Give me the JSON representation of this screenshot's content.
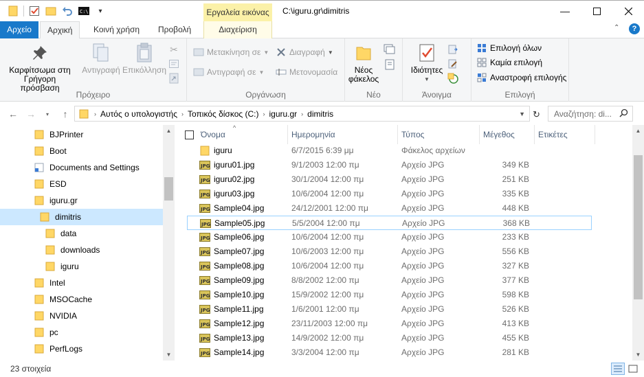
{
  "window": {
    "context_tab_title": "Εργαλεία εικόνας",
    "path_title": "C:\\iguru.gr\\dimitris"
  },
  "tabs": {
    "file": "Αρχείο",
    "home": "Αρχική",
    "share": "Κοινή χρήση",
    "view": "Προβολή",
    "manage": "Διαχείριση"
  },
  "ribbon": {
    "clipboard": {
      "label": "Πρόχειρο",
      "pin_line1": "Καρφίτσωμα στη",
      "pin_line2": "Γρήγορη πρόσβαση",
      "copy": "Αντιγραφή",
      "paste": "Επικόλληση"
    },
    "organize": {
      "label": "Οργάνωση",
      "move_to": "Μετακίνηση σε",
      "copy_to": "Αντιγραφή σε",
      "delete": "Διαγραφή",
      "rename": "Μετονομασία"
    },
    "new": {
      "label": "Νέο",
      "new_folder_line1": "Νέος",
      "new_folder_line2": "φάκελος"
    },
    "open": {
      "label": "Άνοιγμα",
      "properties": "Ιδιότητες"
    },
    "select": {
      "label": "Επιλογή",
      "select_all": "Επιλογή όλων",
      "select_none": "Καμία επιλογή",
      "invert": "Αναστροφή επιλογής"
    }
  },
  "address": {
    "crumbs": [
      "Αυτός ο υπολογιστής",
      "Τοπικός δίσκος (C:)",
      "iguru.gr",
      "dimitris"
    ],
    "search_placeholder": "Αναζήτηση: di..."
  },
  "tree": [
    {
      "label": "BJPrinter"
    },
    {
      "label": "Boot"
    },
    {
      "label": "Documents and Settings"
    },
    {
      "label": "ESD"
    },
    {
      "label": "iguru.gr"
    },
    {
      "label": "dimitris"
    },
    {
      "label": "data"
    },
    {
      "label": "downloads"
    },
    {
      "label": "iguru"
    },
    {
      "label": "Intel"
    },
    {
      "label": "MSOCache"
    },
    {
      "label": "NVIDIA"
    },
    {
      "label": "pc"
    },
    {
      "label": "PerfLogs"
    }
  ],
  "columns": {
    "name": "Όνομα",
    "date": "Ημερομηνία",
    "type": "Τύπος",
    "size": "Μέγεθος",
    "tags": "Ετικέτες"
  },
  "files": [
    {
      "name": "iguru",
      "date": "6/7/2015 6:39 μμ",
      "type": "Φάκελος αρχείων",
      "size": ""
    },
    {
      "name": "iguru01.jpg",
      "date": "9/1/2003 12:00 πμ",
      "type": "Αρχείο JPG",
      "size": "349 KB"
    },
    {
      "name": "iguru02.jpg",
      "date": "30/1/2004 12:00 πμ",
      "type": "Αρχείο JPG",
      "size": "251 KB"
    },
    {
      "name": "iguru03.jpg",
      "date": "10/6/2004 12:00 πμ",
      "type": "Αρχείο JPG",
      "size": "335 KB"
    },
    {
      "name": "Sample04.jpg",
      "date": "24/12/2001 12:00 πμ",
      "type": "Αρχείο JPG",
      "size": "448 KB"
    },
    {
      "name": "Sample05.jpg",
      "date": "5/5/2004 12:00 πμ",
      "type": "Αρχείο JPG",
      "size": "368 KB"
    },
    {
      "name": "Sample06.jpg",
      "date": "10/6/2004 12:00 πμ",
      "type": "Αρχείο JPG",
      "size": "233 KB"
    },
    {
      "name": "Sample07.jpg",
      "date": "10/6/2003 12:00 πμ",
      "type": "Αρχείο JPG",
      "size": "556 KB"
    },
    {
      "name": "Sample08.jpg",
      "date": "10/6/2004 12:00 πμ",
      "type": "Αρχείο JPG",
      "size": "327 KB"
    },
    {
      "name": "Sample09.jpg",
      "date": "8/8/2002 12:00 πμ",
      "type": "Αρχείο JPG",
      "size": "377 KB"
    },
    {
      "name": "Sample10.jpg",
      "date": "15/9/2002 12:00 πμ",
      "type": "Αρχείο JPG",
      "size": "598 KB"
    },
    {
      "name": "Sample11.jpg",
      "date": "1/6/2001 12:00 πμ",
      "type": "Αρχείο JPG",
      "size": "526 KB"
    },
    {
      "name": "Sample12.jpg",
      "date": "23/11/2003 12:00 πμ",
      "type": "Αρχείο JPG",
      "size": "413 KB"
    },
    {
      "name": "Sample13.jpg",
      "date": "14/9/2002 12:00 πμ",
      "type": "Αρχείο JPG",
      "size": "455 KB"
    },
    {
      "name": "Sample14.jpg",
      "date": "3/3/2004 12:00 πμ",
      "type": "Αρχείο JPG",
      "size": "281 KB"
    }
  ],
  "status": {
    "count": "23 στοιχεία"
  },
  "colors": {
    "accent": "#1979ca",
    "folder": "#ffd766",
    "selection": "#cce8ff",
    "context_tab": "#fbf1a8"
  }
}
